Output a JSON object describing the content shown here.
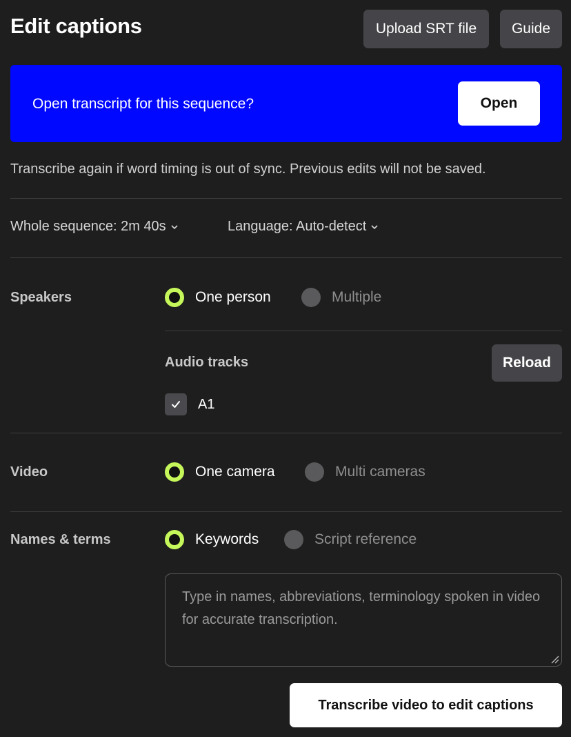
{
  "header": {
    "title": "Edit captions",
    "upload_label": "Upload SRT file",
    "guide_label": "Guide"
  },
  "banner": {
    "text": "Open transcript for this sequence?",
    "open_label": "Open",
    "background": "#0008ff"
  },
  "notice": "Transcribe again if word timing is out of sync. Previous edits will not be saved.",
  "options": {
    "range": "Whole sequence: 2m 40s",
    "language": "Language: Auto-detect"
  },
  "speakers": {
    "label": "Speakers",
    "option_one": "One person",
    "option_multiple": "Multiple",
    "selected": "One person",
    "audio_tracks_label": "Audio tracks",
    "reload_label": "Reload",
    "tracks": [
      {
        "name": "A1",
        "checked": true
      }
    ]
  },
  "video": {
    "label": "Video",
    "option_one": "One camera",
    "option_multi": "Multi cameras",
    "selected": "One camera"
  },
  "names_terms": {
    "label": "Names & terms",
    "option_keywords": "Keywords",
    "option_script": "Script reference",
    "selected": "Keywords",
    "input_value": "",
    "placeholder": "Type in names, abbreviations, terminology spoken in video for accurate transcription."
  },
  "actions": {
    "transcribe_label": "Transcribe video to edit captions"
  },
  "colors": {
    "accent_radio": "#c6f75a",
    "background": "#1e1e1e",
    "button_dark": "#454549"
  }
}
